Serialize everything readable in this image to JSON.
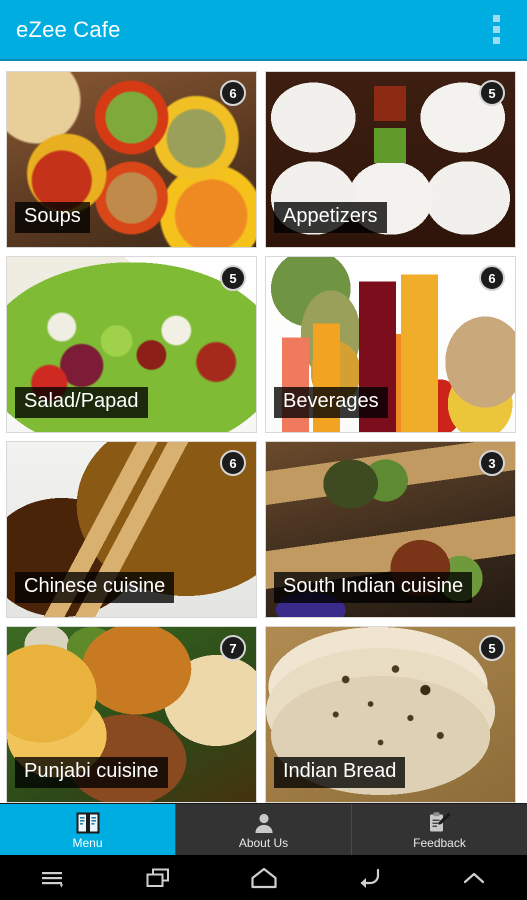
{
  "app": {
    "title": "eZee Cafe",
    "accent_color": "#00ade1",
    "overflow_icon": "overflow-menu-icon"
  },
  "menu_grid": {
    "categories": [
      {
        "name": "Soups",
        "count": "6",
        "photo": "soup-bowls-photo"
      },
      {
        "name": "Appetizers",
        "count": "5",
        "photo": "appetizer-platters-photo"
      },
      {
        "name": "Salad/Papad",
        "count": "5",
        "photo": "green-salad-photo"
      },
      {
        "name": "Beverages",
        "count": "6",
        "photo": "juice-glasses-photo"
      },
      {
        "name": "Chinese cuisine",
        "count": "6",
        "photo": "noodles-chopsticks-photo"
      },
      {
        "name": "South Indian cuisine",
        "count": "3",
        "photo": "dosa-platter-photo"
      },
      {
        "name": "Punjabi cuisine",
        "count": "7",
        "photo": "punjabi-thali-photo"
      },
      {
        "name": "Indian Bread",
        "count": "5",
        "photo": "chapati-stack-photo"
      }
    ]
  },
  "tabbar": {
    "tabs": [
      {
        "label": "Menu",
        "icon": "book-menu-icon",
        "active": true
      },
      {
        "label": "About Us",
        "icon": "person-icon",
        "active": false
      },
      {
        "label": "Feedback",
        "icon": "clipboard-pencil-icon",
        "active": false
      }
    ]
  },
  "system_navbar": {
    "buttons": [
      {
        "icon": "menu-lines-icon"
      },
      {
        "icon": "recents-squares-icon"
      },
      {
        "icon": "home-icon"
      },
      {
        "icon": "back-arrow-icon"
      },
      {
        "icon": "chevron-up-icon"
      }
    ]
  }
}
